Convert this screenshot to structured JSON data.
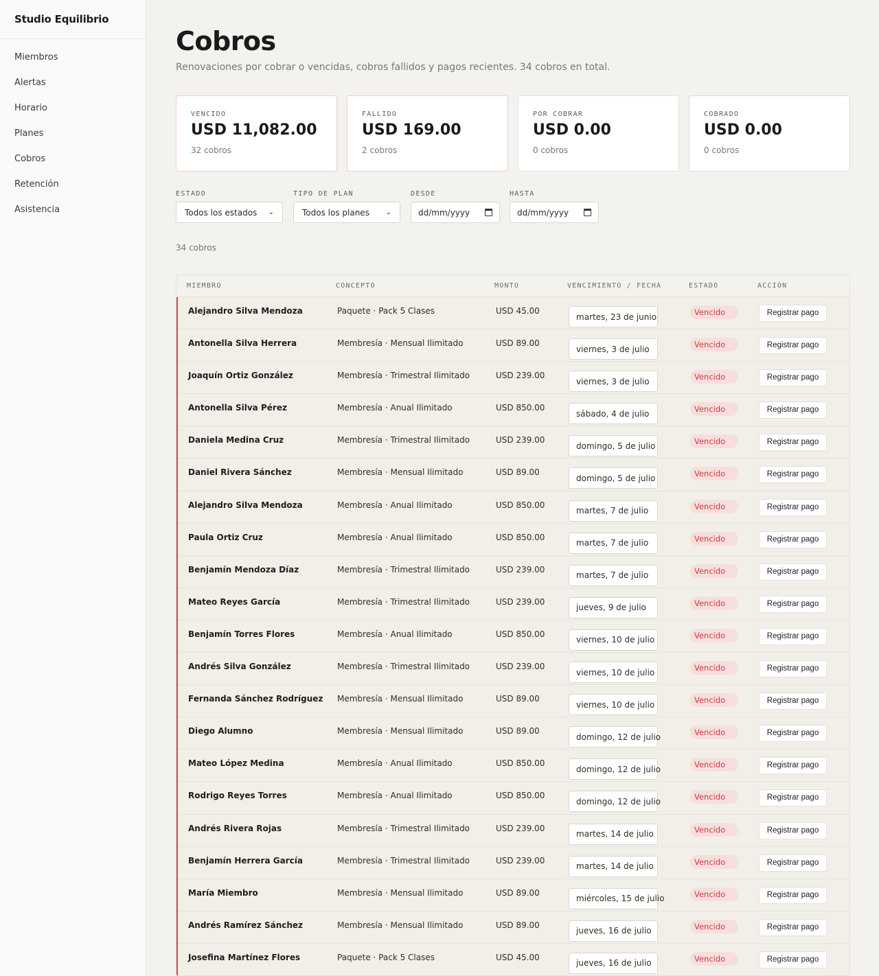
{
  "brand": "Studio Equilibrio",
  "nav": [
    "Miembros",
    "Alertas",
    "Horario",
    "Planes",
    "Cobros",
    "Retención",
    "Asistencia"
  ],
  "header": {
    "title": "Cobros",
    "subtitle": "Renovaciones por cobrar o vencidas, cobros fallidos y pagos recientes. 34 cobros en total."
  },
  "cards": [
    {
      "label": "VENCIDO",
      "value": "USD 11,082.00",
      "count": "32 cobros"
    },
    {
      "label": "FALLIDO",
      "value": "USD 169.00",
      "count": "2 cobros"
    },
    {
      "label": "POR COBRAR",
      "value": "USD 0.00",
      "count": "0 cobros"
    },
    {
      "label": "COBRADO",
      "value": "USD 0.00",
      "count": "0 cobros"
    }
  ],
  "filters": {
    "estado_label": "ESTADO",
    "estado_value": "Todos los estados",
    "plan_label": "TIPO DE PLAN",
    "plan_value": "Todos los planes",
    "desde_label": "DESDE",
    "desde_value": "dd/mm/yyyy",
    "hasta_label": "HASTA",
    "hasta_value": "dd/mm/yyyy"
  },
  "result_count": "34 cobros",
  "table": {
    "headers": [
      "MIEMBRO",
      "CONCEPTO",
      "MONTO",
      "VENCIMIENTO / FECHA",
      "ESTADO",
      "ACCIÓN"
    ],
    "rows": [
      {
        "member": "Alejandro Silva Mendoza",
        "concept": "Paquete · Pack 5 Clases",
        "amount": "USD 45.00",
        "date": "martes, 23 de junio",
        "status": "Vencido",
        "action": "Registrar pago"
      },
      {
        "member": "Antonella Silva Herrera",
        "concept": "Membresía · Mensual Ilimitado",
        "amount": "USD 89.00",
        "date": "viernes, 3 de julio",
        "status": "Vencido",
        "action": "Registrar pago"
      },
      {
        "member": "Joaquín Ortiz González",
        "concept": "Membresía · Trimestral Ilimitado",
        "amount": "USD 239.00",
        "date": "viernes, 3 de julio",
        "status": "Vencido",
        "action": "Registrar pago"
      },
      {
        "member": "Antonella Silva Pérez",
        "concept": "Membresía · Anual Ilimitado",
        "amount": "USD 850.00",
        "date": "sábado, 4 de julio",
        "status": "Vencido",
        "action": "Registrar pago"
      },
      {
        "member": "Daniela Medina Cruz",
        "concept": "Membresía · Trimestral Ilimitado",
        "amount": "USD 239.00",
        "date": "domingo, 5 de julio",
        "status": "Vencido",
        "action": "Registrar pago"
      },
      {
        "member": "Daniel Rivera Sánchez",
        "concept": "Membresía · Mensual Ilimitado",
        "amount": "USD 89.00",
        "date": "domingo, 5 de julio",
        "status": "Vencido",
        "action": "Registrar pago"
      },
      {
        "member": "Alejandro Silva Mendoza",
        "concept": "Membresía · Anual Ilimitado",
        "amount": "USD 850.00",
        "date": "martes, 7 de julio",
        "status": "Vencido",
        "action": "Registrar pago"
      },
      {
        "member": "Paula Ortiz Cruz",
        "concept": "Membresía · Anual Ilimitado",
        "amount": "USD 850.00",
        "date": "martes, 7 de julio",
        "status": "Vencido",
        "action": "Registrar pago"
      },
      {
        "member": "Benjamín Mendoza Díaz",
        "concept": "Membresía · Trimestral Ilimitado",
        "amount": "USD 239.00",
        "date": "martes, 7 de julio",
        "status": "Vencido",
        "action": "Registrar pago"
      },
      {
        "member": "Mateo Reyes García",
        "concept": "Membresía · Trimestral Ilimitado",
        "amount": "USD 239.00",
        "date": "jueves, 9 de julio",
        "status": "Vencido",
        "action": "Registrar pago"
      },
      {
        "member": "Benjamín Torres Flores",
        "concept": "Membresía · Anual Ilimitado",
        "amount": "USD 850.00",
        "date": "viernes, 10 de julio",
        "status": "Vencido",
        "action": "Registrar pago"
      },
      {
        "member": "Andrés Silva González",
        "concept": "Membresía · Trimestral Ilimitado",
        "amount": "USD 239.00",
        "date": "viernes, 10 de julio",
        "status": "Vencido",
        "action": "Registrar pago"
      },
      {
        "member": "Fernanda Sánchez Rodríguez",
        "concept": "Membresía · Mensual Ilimitado",
        "amount": "USD 89.00",
        "date": "viernes, 10 de julio",
        "status": "Vencido",
        "action": "Registrar pago"
      },
      {
        "member": "Diego Alumno",
        "concept": "Membresía · Mensual Ilimitado",
        "amount": "USD 89.00",
        "date": "domingo, 12 de julio",
        "status": "Vencido",
        "action": "Registrar pago"
      },
      {
        "member": "Mateo López Medina",
        "concept": "Membresía · Anual Ilimitado",
        "amount": "USD 850.00",
        "date": "domingo, 12 de julio",
        "status": "Vencido",
        "action": "Registrar pago"
      },
      {
        "member": "Rodrigo Reyes Torres",
        "concept": "Membresía · Anual Ilimitado",
        "amount": "USD 850.00",
        "date": "domingo, 12 de julio",
        "status": "Vencido",
        "action": "Registrar pago"
      },
      {
        "member": "Andrés Rivera Rojas",
        "concept": "Membresía · Trimestral Ilimitado",
        "amount": "USD 239.00",
        "date": "martes, 14 de julio",
        "status": "Vencido",
        "action": "Registrar pago"
      },
      {
        "member": "Benjamín Herrera García",
        "concept": "Membresía · Trimestral Ilimitado",
        "amount": "USD 239.00",
        "date": "martes, 14 de julio",
        "status": "Vencido",
        "action": "Registrar pago"
      },
      {
        "member": "María Miembro",
        "concept": "Membresía · Mensual Ilimitado",
        "amount": "USD 89.00",
        "date": "miércoles, 15 de julio",
        "status": "Vencido",
        "action": "Registrar pago"
      },
      {
        "member": "Andrés Ramírez Sánchez",
        "concept": "Membresía · Mensual Ilimitado",
        "amount": "USD 89.00",
        "date": "jueves, 16 de julio",
        "status": "Vencido",
        "action": "Registrar pago"
      },
      {
        "member": "Josefina Martínez Flores",
        "concept": "Paquete · Pack 5 Clases",
        "amount": "USD 45.00",
        "date": "jueves, 16 de julio",
        "status": "Vencido",
        "action": "Registrar pago"
      }
    ]
  },
  "colors": {
    "overdue_accent": "#d64545",
    "overdue_badge_bg": "#f7dede",
    "overdue_badge_text": "#d13b3b",
    "page_bg": "#f3f2ee"
  }
}
